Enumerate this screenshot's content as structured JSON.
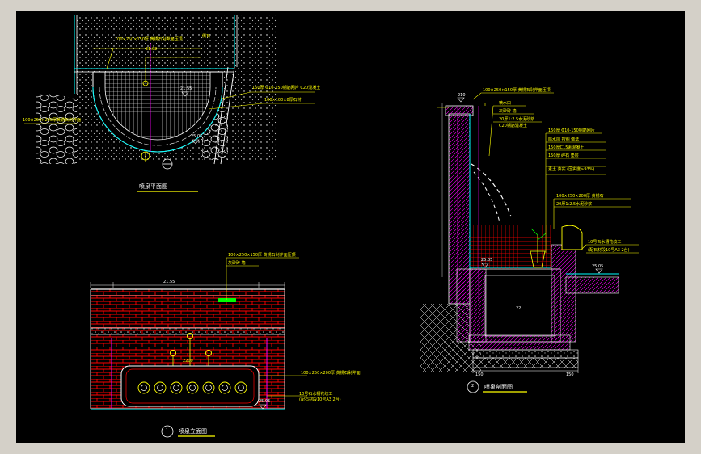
{
  "drawing": {
    "plan": {
      "title": "喷泉平面图",
      "labels": {
        "top_stone": "100×250×150厚 黄锈石剁斧面压顶",
        "edge": "侧石",
        "inner_tile": "150厚 Φ10-150钢筋网片 C20混凝土",
        "gravel": "100×100×8厚石材",
        "pebble": "100×250×200厚黄锈石剁斧面",
        "level_top": "21.55",
        "level_mid": "21.02",
        "level_water": "25.05"
      }
    },
    "elevation": {
      "number": "1",
      "title": "喷泉立面图",
      "labels": {
        "top_stone": "100×250×150厚 黄锈石剁斧面压顶",
        "wall": "灰砂砖 墙",
        "base": "100×250×200厚 黄锈石剁斧面",
        "fountain": "10号石水槽花纹工",
        "fountain_note": "(配石材段10号A3 2台)",
        "level_top": "21.55",
        "level_bottom": "25.05",
        "level_mid": "2200"
      }
    },
    "section": {
      "number": "2",
      "title": "喷泉剖面图",
      "labels": {
        "top_stone": "100×250×150厚 黄锈石剁斧面压顶",
        "spout": "喷水口",
        "wall": "灰砂砖 墙",
        "mortar": "20厚1:2.5水泥砂浆",
        "concrete": "C20钢筋混凝土",
        "rebar": "150厚 Φ10-150钢筋网片",
        "waterproof": "防水层 按图 做法",
        "tile": "150厚C15素混凝土",
        "gravel": "150厚 碎石 垫层",
        "soil": "素土 夯实 (压实度≥93%)",
        "rim": "100×250×200厚 黄锈石",
        "rim_mortar": "20厚1:2.5水泥砂浆",
        "pot": "10号石水槽花纹工",
        "pot_note": "(配石材段10号A3 2台)",
        "level_top": "210",
        "level_water": "25.05",
        "level_bottom": "22",
        "dim_left": "150",
        "dim_right": "150"
      }
    }
  },
  "colors": {
    "background": "#000000",
    "frame": "#d4d0c8",
    "annotation": "#ffff00",
    "brick": "#ff0000",
    "water": "#00ffff",
    "line": "#ffffff"
  }
}
